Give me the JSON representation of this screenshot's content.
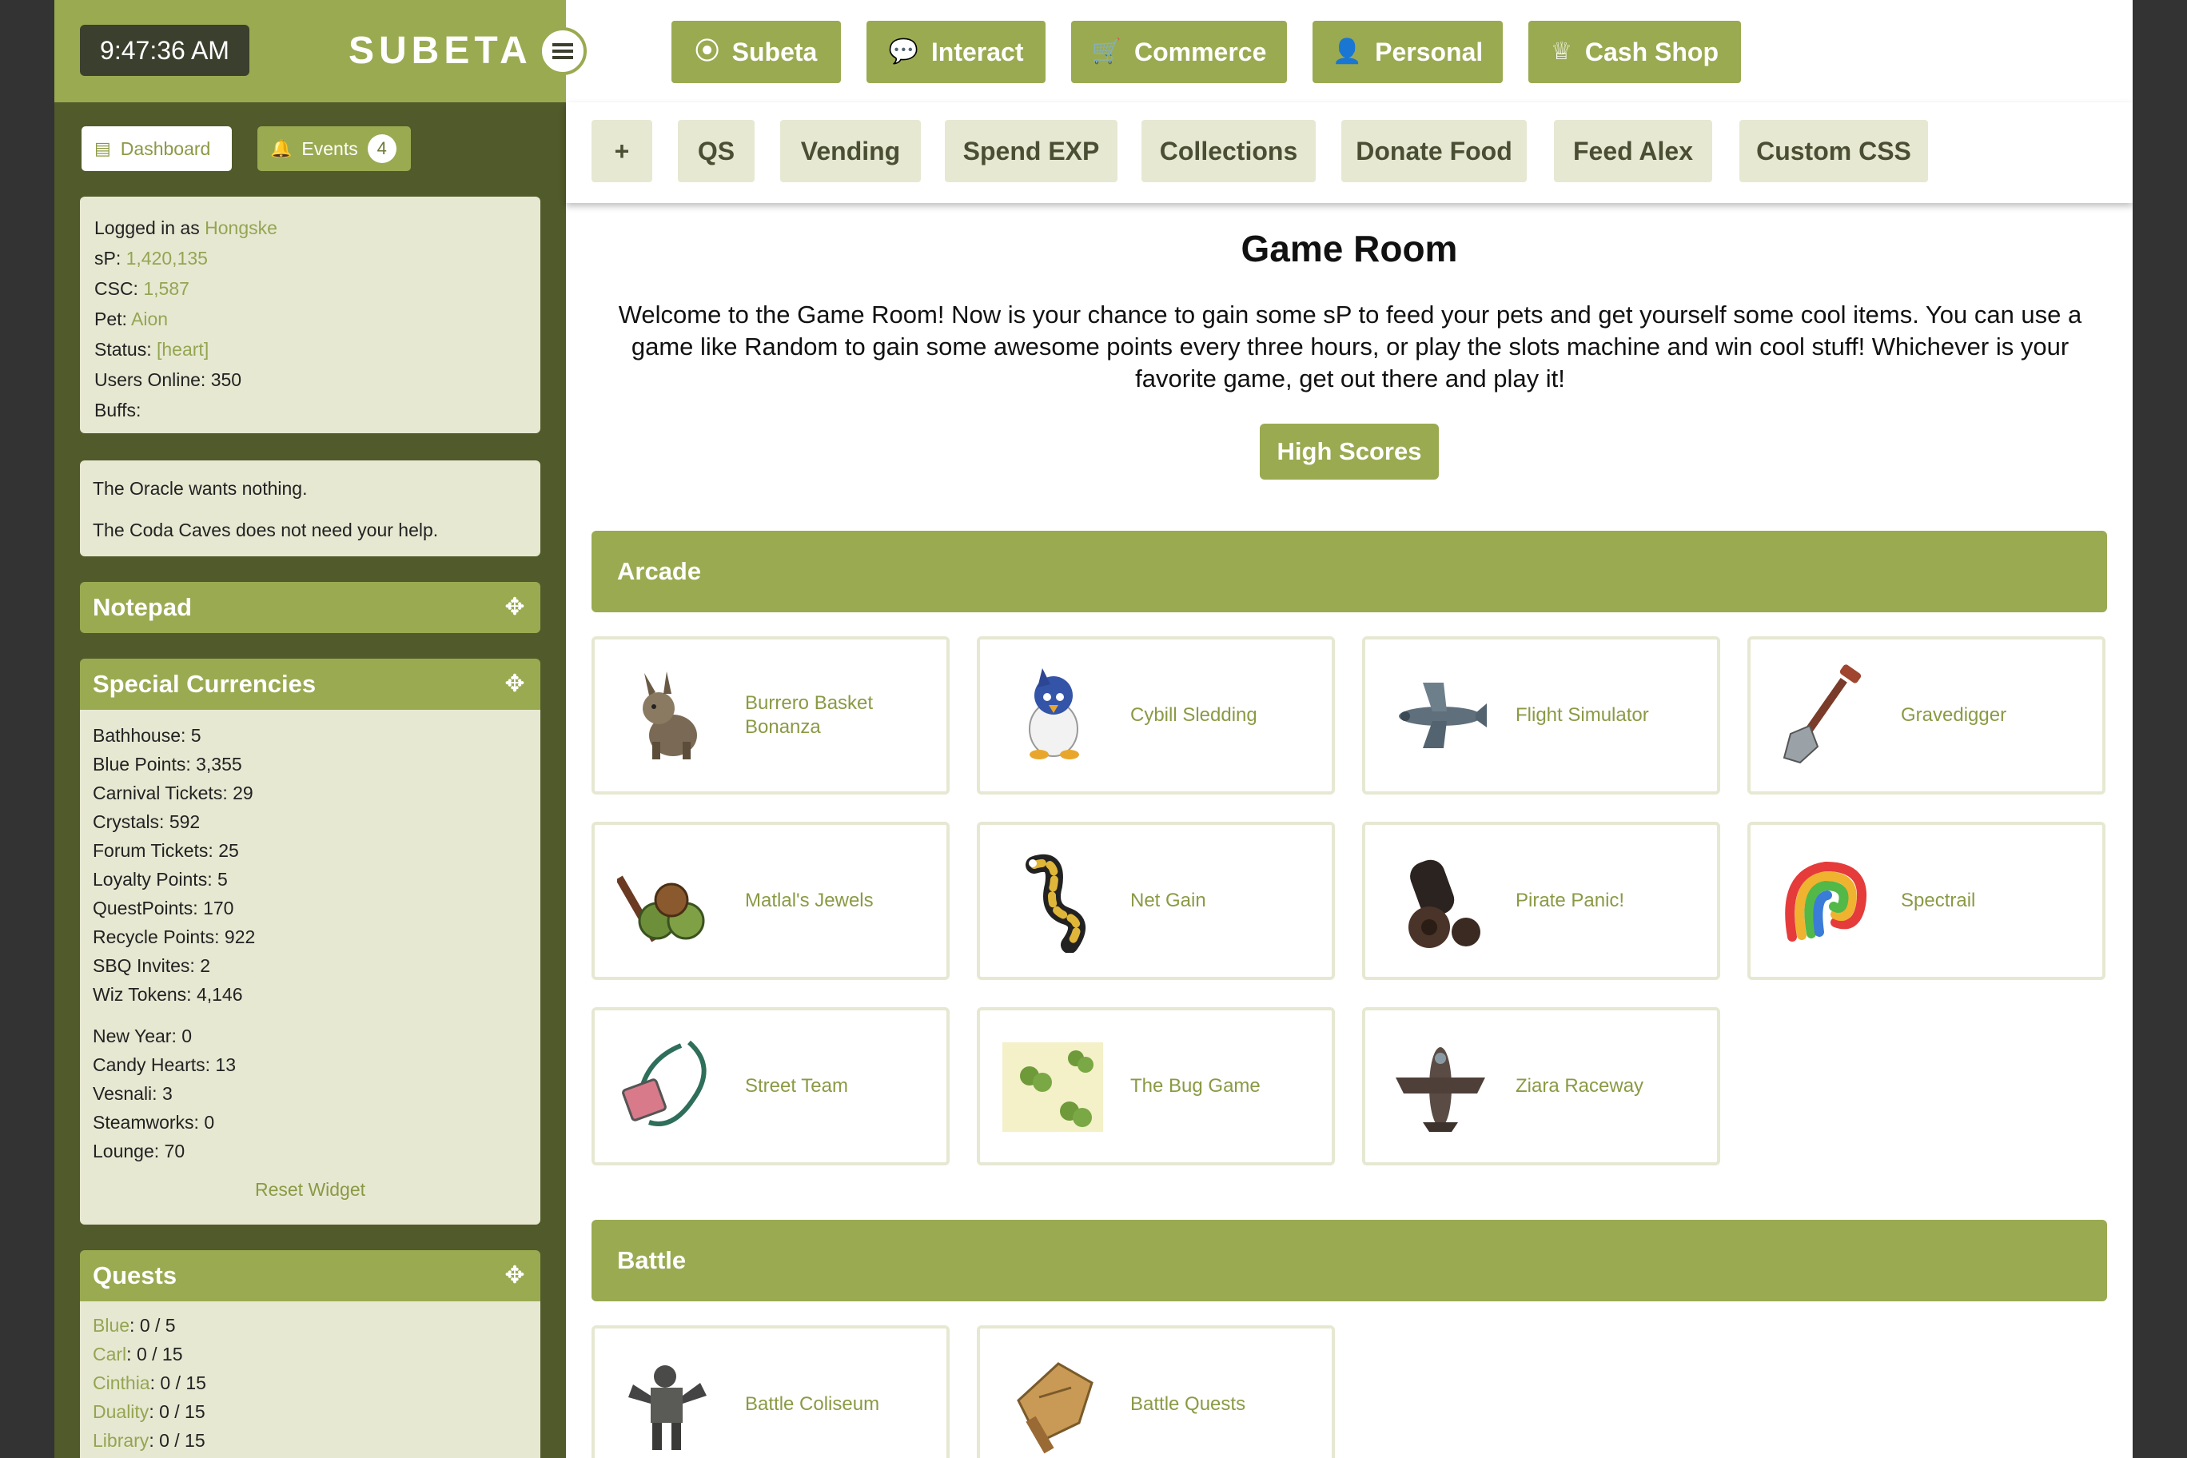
{
  "clock": "9:47:36 AM",
  "brand": "SUBETA",
  "top_nav": [
    {
      "label": "Subeta",
      "icon": "compass-icon"
    },
    {
      "label": "Interact",
      "icon": "chat-bubbles-icon"
    },
    {
      "label": "Commerce",
      "icon": "cart-icon"
    },
    {
      "label": "Personal",
      "icon": "user-icon"
    },
    {
      "label": "Cash Shop",
      "icon": "crown-icon"
    }
  ],
  "sub_nav": [
    "+",
    "QS",
    "Vending",
    "Spend EXP",
    "Collections",
    "Donate Food",
    "Feed Alex",
    "Custom CSS"
  ],
  "sidebar": {
    "dashboard_label": "Dashboard",
    "events_label": "Events",
    "events_count": "4",
    "user": {
      "logged_in_prefix": "Logged in as",
      "username": "Hongske",
      "sp_label": "sP:",
      "sp": "1,420,135",
      "csc_label": "CSC:",
      "csc": "1,587",
      "pet_label": "Pet:",
      "pet": "Aion",
      "status_label": "Status:",
      "status": "[heart]",
      "online": "Users Online: 350",
      "buffs": "Buffs:"
    },
    "oracle": [
      "The Oracle wants nothing.",
      "The Coda Caves does not need your help."
    ],
    "notepad_title": "Notepad",
    "currencies_title": "Special Currencies",
    "currencies": [
      "Bathhouse: 5",
      "Blue Points: 3,355",
      "Carnival Tickets: 29",
      "Crystals: 592",
      "Forum Tickets: 25",
      "Loyalty Points: 5",
      "QuestPoints: 170",
      "Recycle Points: 922",
      "SBQ Invites: 2",
      "Wiz Tokens: 4,146"
    ],
    "event_currencies": [
      "New Year: 0",
      "Candy Hearts: 13",
      "Vesnali: 3",
      "Steamworks: 0",
      "Lounge: 70"
    ],
    "reset_label": "Reset Widget",
    "quests_title": "Quests",
    "quests": [
      {
        "name": "Blue",
        "progress": ": 0 / 5"
      },
      {
        "name": "Carl",
        "progress": ": 0 / 15"
      },
      {
        "name": "Cinthia",
        "progress": ": 0 / 15"
      },
      {
        "name": "Duality",
        "progress": ": 0 / 15"
      },
      {
        "name": "Library",
        "progress": ": 0 / 15"
      }
    ]
  },
  "main": {
    "title": "Game Room",
    "intro": "Welcome to the Game Room! Now is your chance to gain some sP to feed your pets and get yourself some cool items. You can use a game like Random to gain some awesome points every three hours, or play the slots machine and win cool stuff! Whichever is your favorite game, get out there and play it!",
    "high_scores": "High Scores",
    "sections": [
      {
        "title": "Arcade",
        "games": [
          {
            "name": "Burrero Basket Bonanza",
            "icon": "donkey-icon"
          },
          {
            "name": "Cybill Sledding",
            "icon": "penguin-icon"
          },
          {
            "name": "Flight Simulator",
            "icon": "airplane-icon"
          },
          {
            "name": "Gravedigger",
            "icon": "shovel-icon"
          },
          {
            "name": "Matlal's Jewels",
            "icon": "fruit-bunch-icon"
          },
          {
            "name": "Net Gain",
            "icon": "caterpillar-icon"
          },
          {
            "name": "Pirate Panic!",
            "icon": "cannon-icon"
          },
          {
            "name": "Spectrail",
            "icon": "rainbow-icon"
          },
          {
            "name": "Street Team",
            "icon": "lanyard-badge-icon"
          },
          {
            "name": "The Bug Game",
            "icon": "bugs-icon"
          },
          {
            "name": "Ziara Raceway",
            "icon": "racer-plane-icon"
          }
        ]
      },
      {
        "title": "Battle",
        "games": [
          {
            "name": "Battle Coliseum",
            "icon": "robot-warrior-icon"
          },
          {
            "name": "Battle Quests",
            "icon": "map-scroll-icon"
          }
        ]
      }
    ]
  }
}
